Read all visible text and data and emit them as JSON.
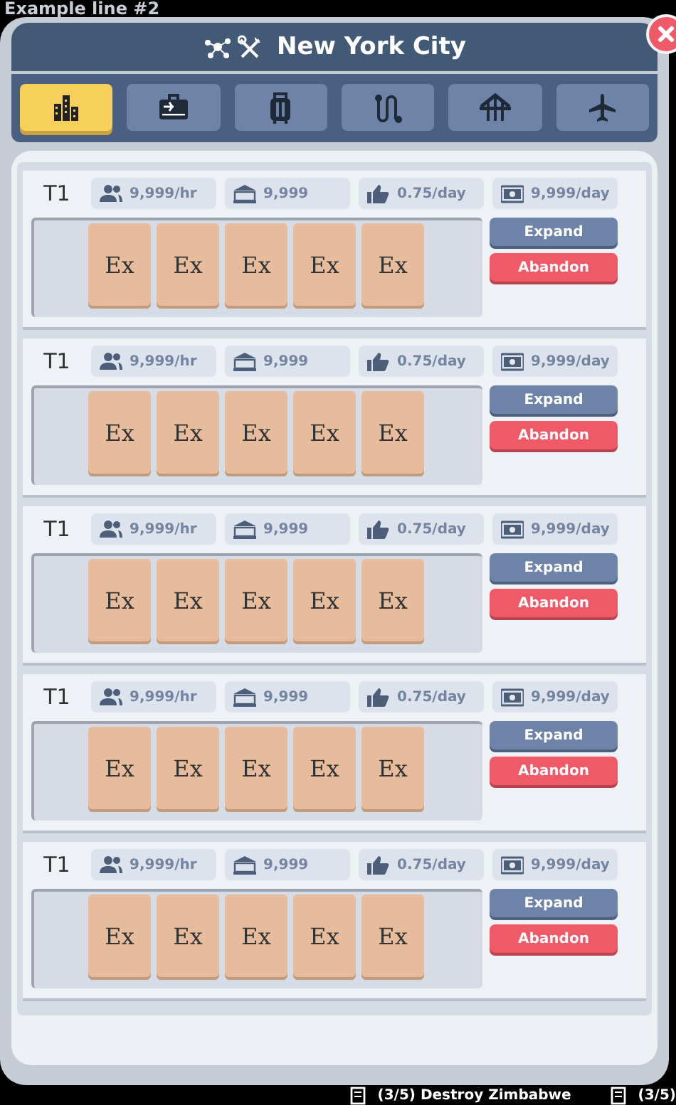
{
  "caption": "Example line #2",
  "window": {
    "title": "New York City",
    "tabs": [
      {
        "selected": true
      },
      {
        "selected": false
      },
      {
        "selected": false
      },
      {
        "selected": false
      },
      {
        "selected": false
      },
      {
        "selected": false
      }
    ]
  },
  "lines": [
    {
      "tier": "T1",
      "stats": [
        "9,999/hr",
        "9,999",
        "0.75/day",
        "9,999/day"
      ],
      "slots": [
        "Ex",
        "Ex",
        "Ex",
        "Ex",
        "Ex"
      ],
      "buttons": [
        {
          "kind": "expand",
          "label": "Expand"
        },
        {
          "kind": "abandon",
          "label": "Abandon"
        }
      ]
    },
    {
      "tier": "T1",
      "stats": [
        "9,999/hr",
        "9,999",
        "0.75/day",
        "9,999/day"
      ],
      "slots": [
        "Ex",
        "Ex",
        "Ex",
        "Ex",
        "Ex"
      ],
      "buttons": [
        {
          "kind": "expand",
          "label": "Expand"
        },
        {
          "kind": "abandon",
          "label": "Abandon"
        }
      ]
    },
    {
      "tier": "T1",
      "stats": [
        "9,999/hr",
        "9,999",
        "0.75/day",
        "9,999/day"
      ],
      "slots": [
        "Ex",
        "Ex",
        "Ex",
        "Ex",
        "Ex"
      ],
      "buttons": [
        {
          "kind": "expand",
          "label": "Expand"
        },
        {
          "kind": "abandon",
          "label": "Abandon"
        }
      ]
    },
    {
      "tier": "T1",
      "stats": [
        "9,999/hr",
        "9,999",
        "0.75/day",
        "9,999/day"
      ],
      "slots": [
        "Ex",
        "Ex",
        "Ex",
        "Ex",
        "Ex"
      ],
      "buttons": [
        {
          "kind": "expand",
          "label": "Expand"
        },
        {
          "kind": "abandon",
          "label": "Abandon"
        }
      ]
    },
    {
      "tier": "T1",
      "stats": [
        "9,999/hr",
        "9,999",
        "0.75/day",
        "9,999/day"
      ],
      "slots": [
        "Ex",
        "Ex",
        "Ex",
        "Ex",
        "Ex"
      ],
      "buttons": [
        {
          "kind": "expand",
          "label": "Expand"
        },
        {
          "kind": "abandon",
          "label": "Abandon"
        }
      ]
    }
  ],
  "ticker": [
    "(3/5) Destroy Zimbabwe",
    "(3/5)"
  ]
}
